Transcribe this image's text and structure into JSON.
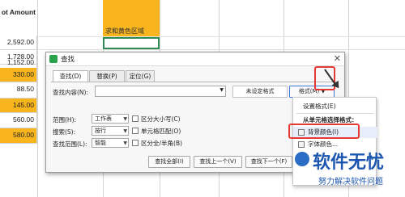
{
  "sheet": {
    "header": "ot Amount",
    "values": [
      "2,592.00",
      "1,728.00",
      "1,152.00",
      "330.00",
      "88.50",
      "145.00",
      "560.00",
      "580.00"
    ],
    "highlight_rows": [
      3,
      5,
      7
    ],
    "highlight_color": "#f8b51e",
    "region_label": "求和黄色区域"
  },
  "dialog": {
    "title": "查找",
    "tabs": [
      "查找(D)",
      "替换(P)",
      "定位(G)"
    ],
    "find_label": "查找内容(N):",
    "find_value": "",
    "format_status": "未设定格式",
    "format_button": "格式(M)",
    "options": [
      {
        "label": "范围(H):",
        "value": "工作表"
      },
      {
        "label": "搜索(S):",
        "value": "按行"
      },
      {
        "label": "查找范围(L):",
        "value": "智能"
      }
    ],
    "checkboxes": [
      "区分大小写(C)",
      "单元格匹配(O)",
      "区分全/半角(B)"
    ],
    "buttons": [
      "查找全部(I)",
      "查找上一个(V)",
      "查找下一个(F)"
    ]
  },
  "menu": {
    "items": [
      "设置格式(E)",
      "从单元格选择格式：",
      "背景颜色(I)",
      "字体颜色..."
    ]
  },
  "watermark": {
    "main": "软件无忧",
    "sub": "努力解决软件问题"
  }
}
